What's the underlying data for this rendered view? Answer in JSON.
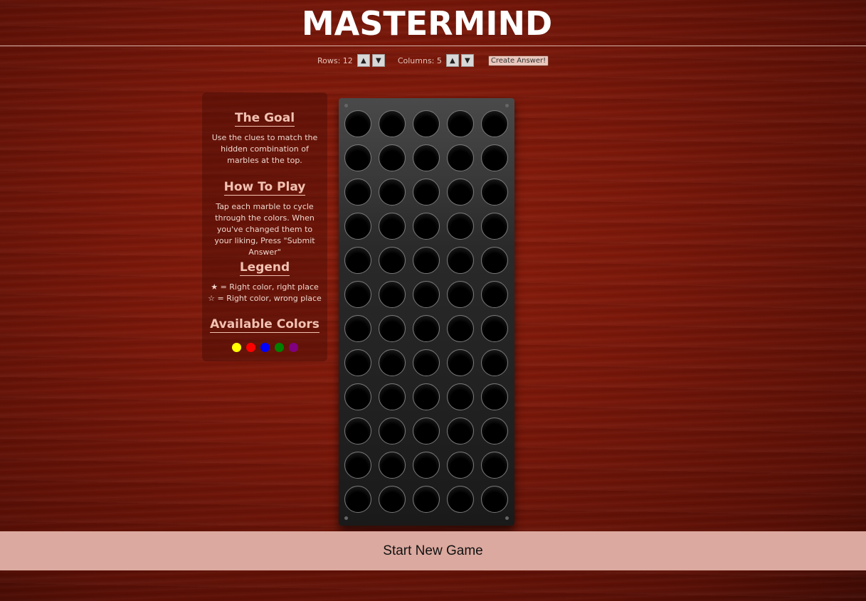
{
  "title": "MASTERMIND",
  "controls": {
    "rows_label": "Rows: 12",
    "columns_label": "Columns: 5",
    "up_arrow": "▲",
    "down_arrow": "▼",
    "create_answer": "Create Answer!"
  },
  "info": {
    "goal_title": "The Goal",
    "goal_text": "Use the clues to match the hidden combination of marbles at the top.",
    "howto_title": "How To Play",
    "howto_text": "Tap each marble to cycle through the colors. When you've changed them to your liking, Press \"Submit Answer\"",
    "legend_title": "Legend",
    "legend_line1": "★ = Right color, right place",
    "legend_line2": "☆ = Right color, wrong place",
    "colors_title": "Available Colors",
    "available_colors": [
      "#ffff00",
      "#ff0000",
      "#0000ff",
      "#008000",
      "#800080"
    ]
  },
  "board": {
    "rows": 12,
    "columns": 5
  },
  "footer": {
    "new_game": "Start New Game"
  }
}
